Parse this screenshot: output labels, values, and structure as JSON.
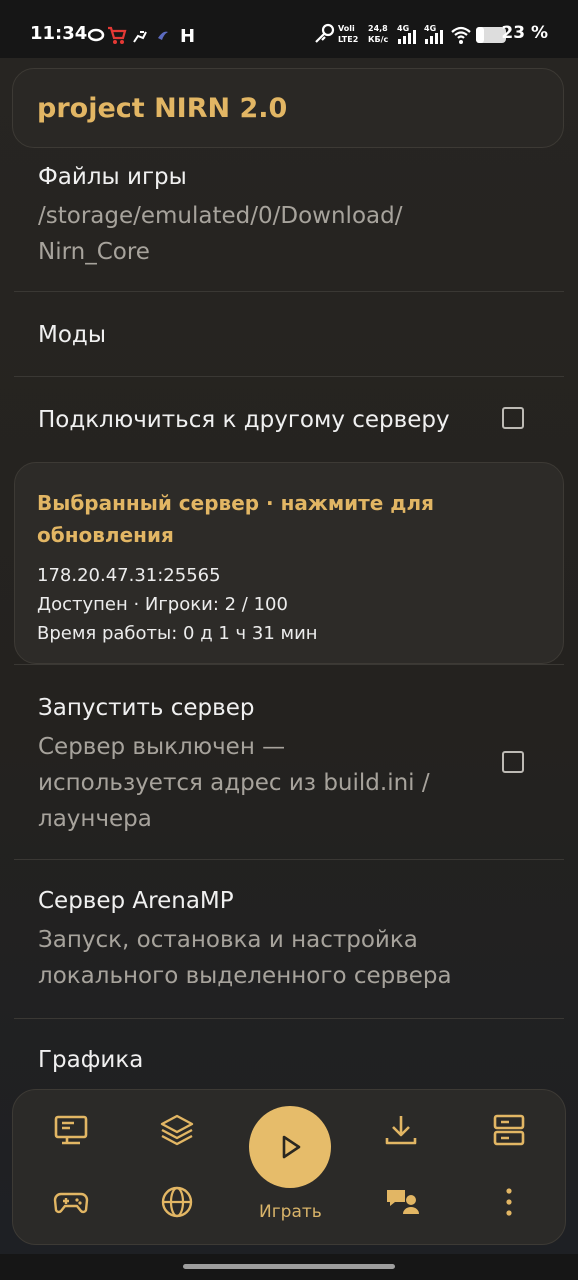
{
  "status_bar": {
    "time": "11:34",
    "signal_1": "Voli LTE2",
    "net_speed": "24,8 КБ/с",
    "net_4g_a": "4G",
    "net_4g_b": "4G",
    "battery_percent": "23 %",
    "left_icons": [
      "ring-icon",
      "cart-icon",
      "runner-icon",
      "bird-icon",
      "h-icon"
    ]
  },
  "app": {
    "title": "project NIRN 2.0"
  },
  "preferences": {
    "game_files": {
      "title": "Файлы игры",
      "path_line1": "/storage/emulated/0/Download/",
      "path_line2": "Nirn_Core"
    },
    "mods": {
      "title": "Моды"
    },
    "connect_other": {
      "title": "Подключиться к другому серверу",
      "checked": false
    },
    "server_card": {
      "title_line1": "Выбранный сервер · нажмите для",
      "title_line2": "обновления",
      "address": "178.20.47.31:25565",
      "status": "Доступен · Игроки: 2 / 100",
      "uptime": "Время работы: 0 д 1 ч 31 мин"
    },
    "launch_server": {
      "title": "Запустить сервер",
      "sub_line1": "Сервер выключен —",
      "sub_line2": "используется адрес из build.ini /",
      "sub_line3": "лаунчера",
      "checked": false
    },
    "arena_server": {
      "title": "Сервер ArenaMP",
      "sub_line1": "Запуск, остановка и настройка",
      "sub_line2": "локального выделенного сервера"
    },
    "graphics": {
      "title": "Графика"
    }
  },
  "bottom_nav": {
    "play_label": "Играть",
    "top_row_icons": [
      "monitor-icon",
      "layers-icon",
      "download-icon",
      "server-icon"
    ],
    "bottom_row_icons": [
      "gamepad-icon",
      "globe-icon",
      "chat-user-icon",
      "more-vert-icon"
    ]
  },
  "colors": {
    "accent": "#e2b664",
    "play_button": "#e6bc6a",
    "background": "#24221f",
    "subtitle": "#a7a39c"
  }
}
